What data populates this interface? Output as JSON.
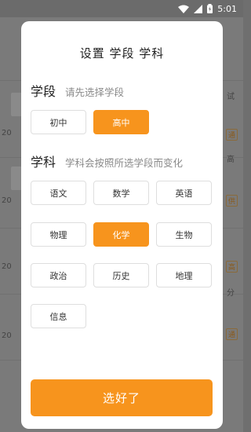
{
  "status_bar": {
    "time": "5:01"
  },
  "background": {
    "fragments": [
      "试",
      "20",
      "高",
      "20",
      "20",
      "分",
      "20"
    ],
    "tags": [
      "通",
      "供",
      "高",
      "通"
    ]
  },
  "modal": {
    "title": "设置 学段 学科",
    "stage": {
      "label": "学段",
      "hint": "请先选择学段",
      "options": [
        "初中",
        "高中"
      ],
      "selected": "高中"
    },
    "subject": {
      "label": "学科",
      "hint": "学科会按照所选学段而变化",
      "options": [
        "语文",
        "数学",
        "英语",
        "物理",
        "化学",
        "生物",
        "政治",
        "历史",
        "地理",
        "信息"
      ],
      "selected": "化学"
    },
    "confirm_label": "选好了"
  },
  "colors": {
    "accent": "#f7941d",
    "overlay": "#6f6f6f"
  }
}
